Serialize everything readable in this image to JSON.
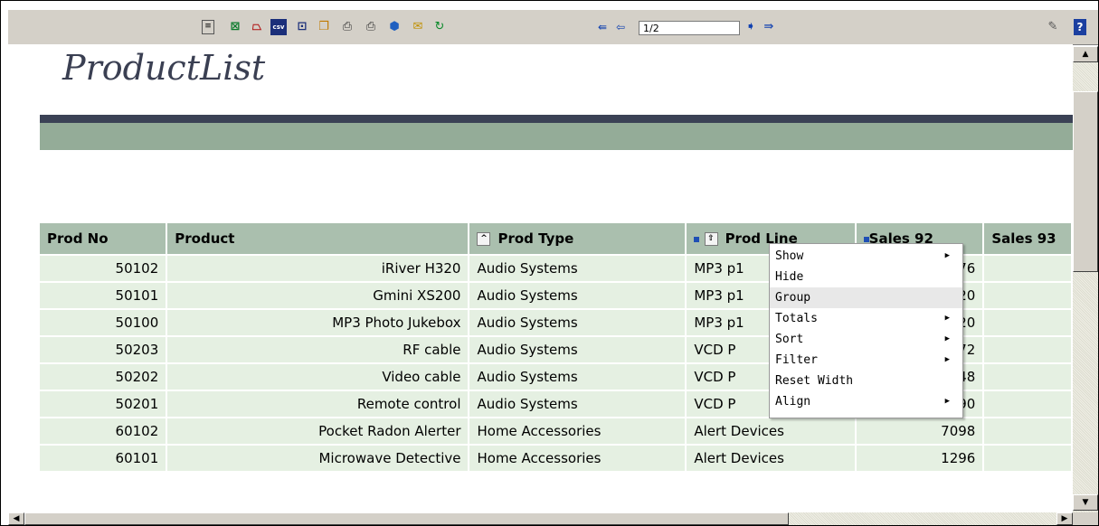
{
  "toolbar": {
    "icons": [
      "page-icon",
      "excel-icon",
      "pdf-icon",
      "csv-icon",
      "word-icon",
      "copy-icon",
      "print-icon",
      "print-preview-icon",
      "network-icon",
      "email-icon",
      "refresh-icon",
      "first-page-icon",
      "previous-page-icon",
      "next-page-icon",
      "last-page-icon",
      "edit-icon",
      "help-icon"
    ],
    "page_value": "1/2"
  },
  "report": {
    "title": "ProductList",
    "columns": [
      "Prod No",
      "Product",
      "Prod Type",
      "Prod Line",
      "Sales 92",
      "Sales 93"
    ],
    "rows": [
      [
        "50102",
        "iRiver H320",
        "Audio Systems",
        "MP3 p1",
        "976"
      ],
      [
        "50101",
        "Gmini XS200",
        "Audio Systems",
        "MP3 p1",
        "720"
      ],
      [
        "50100",
        "MP3 Photo Jukebox",
        "Audio Systems",
        "MP3 p1",
        "120"
      ],
      [
        "50203",
        "RF cable",
        "Audio Systems",
        "VCD P",
        "372"
      ],
      [
        "50202",
        "Video cable",
        "Audio Systems",
        "VCD P",
        "348"
      ],
      [
        "50201",
        "Remote control",
        "Audio Systems",
        "VCD P",
        "4190"
      ],
      [
        "60102",
        "Pocket Radon Alerter",
        "Home Accessories",
        "Alert Devices",
        "7098"
      ],
      [
        "60101",
        "Microwave Detective",
        "Home Accessories",
        "Alert Devices",
        "1296"
      ]
    ]
  },
  "context_menu": {
    "items": [
      "Show",
      "Hide",
      "Group",
      "Totals",
      "Sort",
      "Filter",
      "Reset Width",
      "Align"
    ],
    "highlighted": "Group"
  },
  "colors": {
    "header_band": "#3b4255",
    "green_band": "#94ac98",
    "header_cell": "#aabfae",
    "row_cell": "#e5f0e2"
  }
}
